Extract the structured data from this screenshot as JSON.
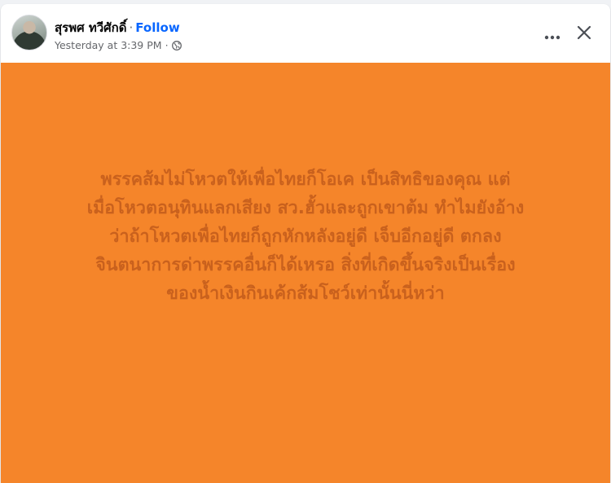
{
  "post": {
    "author_name": "สุรพศ ทวีศักดิ์",
    "separator": "·",
    "follow_label": "Follow",
    "timestamp": "Yesterday at 3:39 PM",
    "meta_separator": "·",
    "privacy_icon": "globe-icon",
    "more_icon": "more-options-icon",
    "close_icon": "close-icon",
    "background_color": "#f5852a",
    "text_color": "#c9611d",
    "body": "พรรคส้มไม่โหวตให้เพื่อไทยก็โอเค เป็นสิทธิของคุณ แต่\nเมื่อโหวตอนุทินแลกเสียง สว.ฮั้วและถูกเขาต้ม ทำไมยังอ้าง\nว่าถ้าโหวตเพื่อไทยก็ถูกหักหลังอยู่ดี เจ็บอีกอยู่ดี ตกลง\nจินตนาการด่าพรรคอื่นก็ได้เหรอ สิ่งที่เกิดขึ้นจริงเป็นเรื่อง\nของน้ำเงินกินเค้กส้มโชว์เท่านั้นนี่หว่า"
  }
}
